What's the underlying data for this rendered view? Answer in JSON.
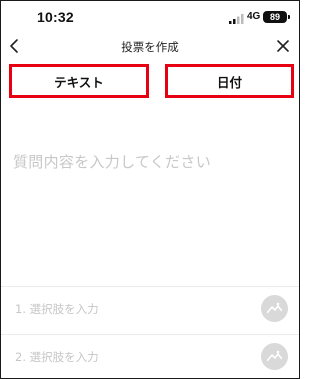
{
  "status_bar": {
    "time": "10:32",
    "network": "4G",
    "battery": "89"
  },
  "nav": {
    "title": "投票を作成"
  },
  "tabs": [
    {
      "label": "テキスト"
    },
    {
      "label": "日付"
    }
  ],
  "question": {
    "placeholder": "質問内容を入力してください"
  },
  "options": [
    {
      "placeholder": "1. 選択肢を入力"
    },
    {
      "placeholder": "2. 選択肢を入力"
    }
  ],
  "colors": {
    "highlight_border": "#e60012",
    "placeholder_text": "#c8c8c8"
  },
  "icons": [
    "signal-icon",
    "back-icon",
    "close-icon",
    "image-icon"
  ]
}
